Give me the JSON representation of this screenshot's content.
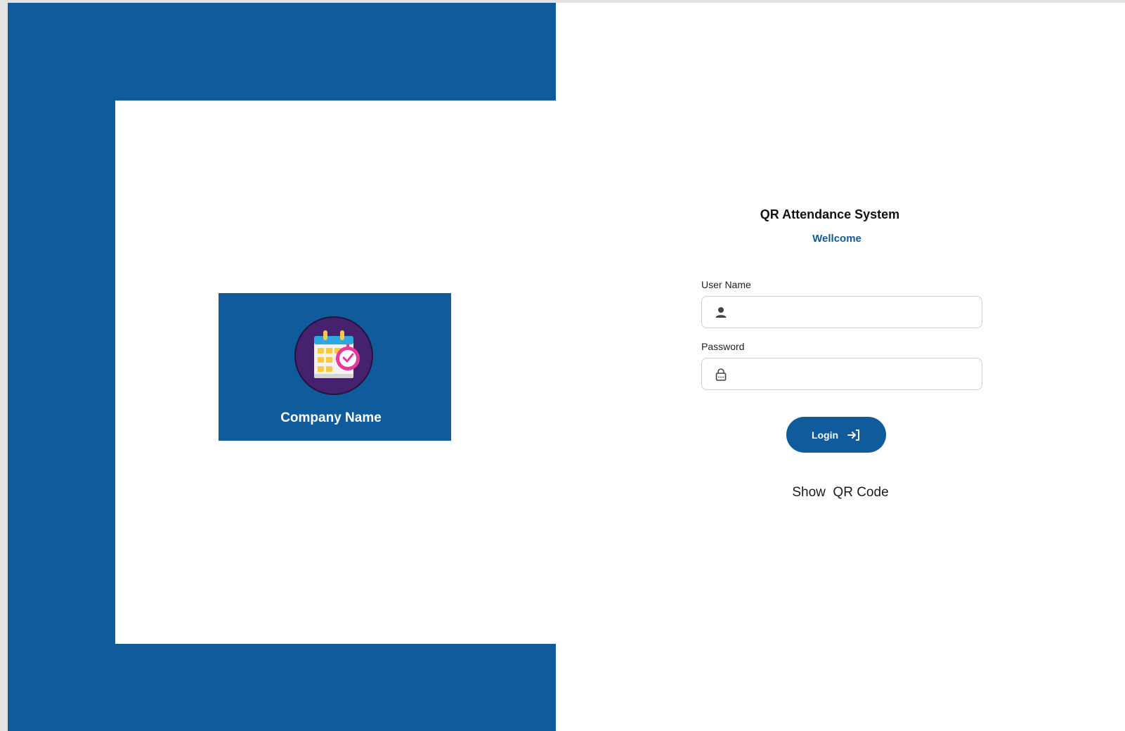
{
  "branding": {
    "company_name": "Company Name",
    "logo_icon": "calendar-clock-icon",
    "brand_color": "#105b9c"
  },
  "login": {
    "title": "QR Attendance System",
    "welcome": "Wellcome",
    "username_label": "User Name",
    "username_value": "",
    "username_icon": "user-icon",
    "password_label": "Password",
    "password_value": "",
    "password_icon": "lock-icon",
    "login_button_label": "Login",
    "login_button_icon": "sign-in-icon",
    "show_qr_label": "Show  QR Code"
  }
}
